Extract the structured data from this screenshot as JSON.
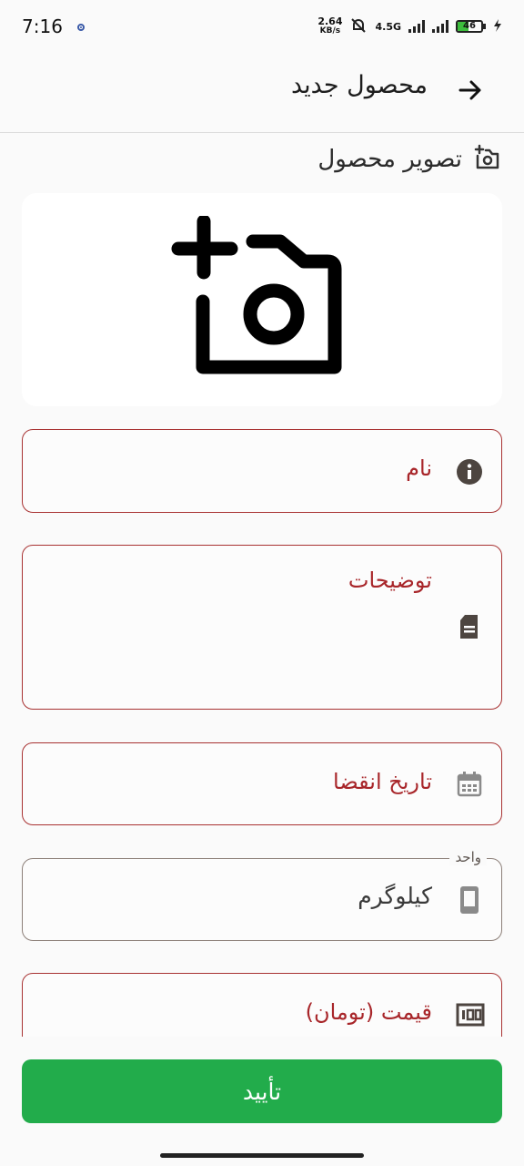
{
  "status": {
    "time": "7:16",
    "net_speed_value": "2.64",
    "net_speed_unit": "KB/s",
    "network": "4.5G",
    "battery": "46"
  },
  "header": {
    "title": "محصول جدید"
  },
  "photo_section": {
    "title": "تصویر محصول"
  },
  "form": {
    "name_label": "نام",
    "description_label": "توضیحات",
    "expiry_label": "تاریخ انقضا",
    "unit_label": "واحد",
    "unit_value": "کیلوگرم",
    "price_label": "قیمت (تومان)"
  },
  "actions": {
    "confirm_label": "تأیید"
  },
  "colors": {
    "accent_error": "#a83232",
    "confirm": "#22ac4b"
  }
}
